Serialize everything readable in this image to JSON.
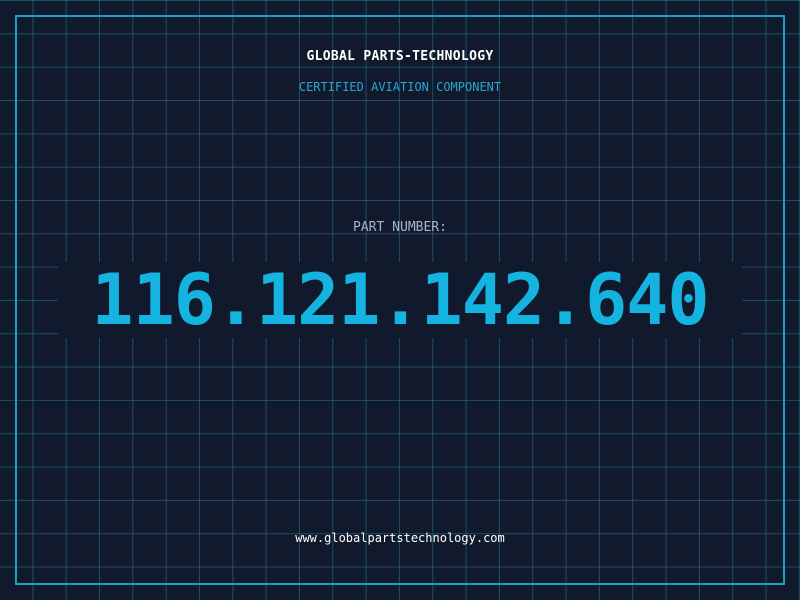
{
  "header": {
    "company_name": "GLOBAL PARTS-TECHNOLOGY",
    "subtitle": "CERTIFIED AVIATION COMPONENT"
  },
  "part": {
    "label": "PART NUMBER:",
    "number": "116.121.142.640"
  },
  "footer": {
    "website": "www.globalpartstechnology.com"
  },
  "colors": {
    "background": "#111a2d",
    "grid": "#227896",
    "frame": "#1aa0c8",
    "accent": "#14b3e0",
    "subtitle": "#29a6d4",
    "label": "#aab4c4",
    "text": "#ffffff"
  }
}
